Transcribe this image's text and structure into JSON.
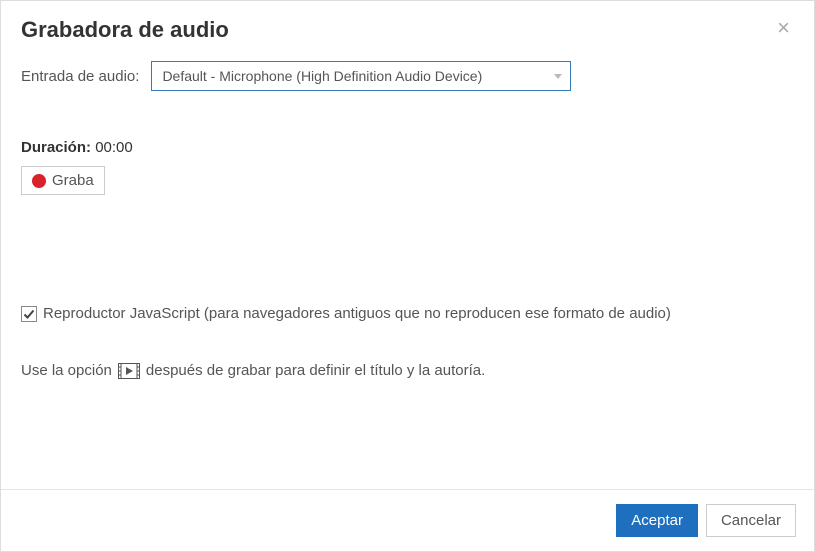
{
  "dialog": {
    "title": "Grabadora de audio"
  },
  "input": {
    "label": "Entrada de audio:",
    "selected": "Default - Microphone (High Definition Audio Device)"
  },
  "duration": {
    "label": "Duración:",
    "value": "00:00"
  },
  "record": {
    "label": "Graba"
  },
  "jsplayer": {
    "checked": true,
    "label": "Reproductor JavaScript (para navegadores antiguos que no reproducen ese formato de audio)"
  },
  "hint": {
    "prefix": "Use la opción",
    "suffix": "después de grabar para definir el título y la autoría."
  },
  "footer": {
    "accept": "Aceptar",
    "cancel": "Cancelar"
  }
}
